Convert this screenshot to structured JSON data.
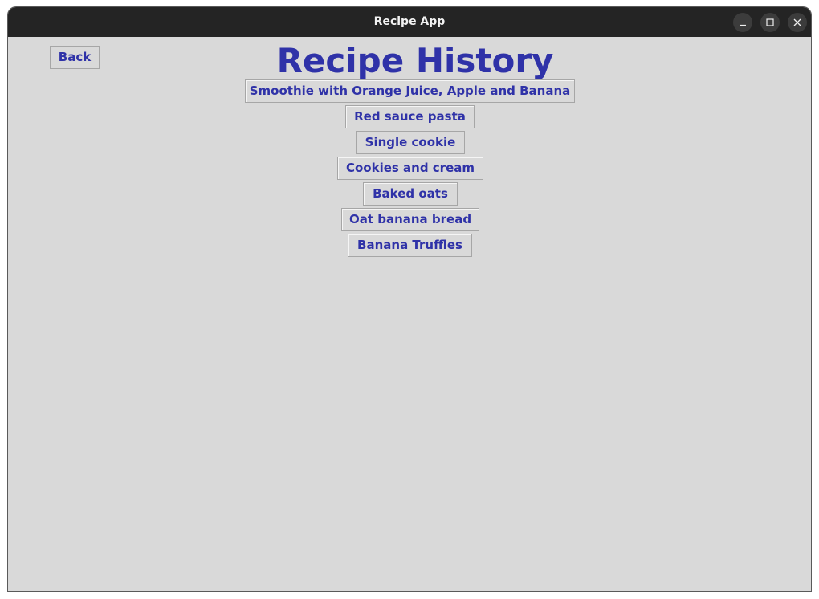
{
  "window": {
    "title": "Recipe App"
  },
  "toolbar": {
    "back_label": "Back"
  },
  "page": {
    "heading": "Recipe History"
  },
  "recipes": [
    "Smoothie with Orange Juice, Apple and Banana",
    "Red sauce pasta",
    "Single cookie",
    "Cookies and cream",
    "Baked oats",
    "Oat banana bread",
    "Banana Truffles"
  ],
  "colors": {
    "accent": "#2f32a8",
    "background": "#d9d9d9",
    "titlebar": "#242424"
  }
}
